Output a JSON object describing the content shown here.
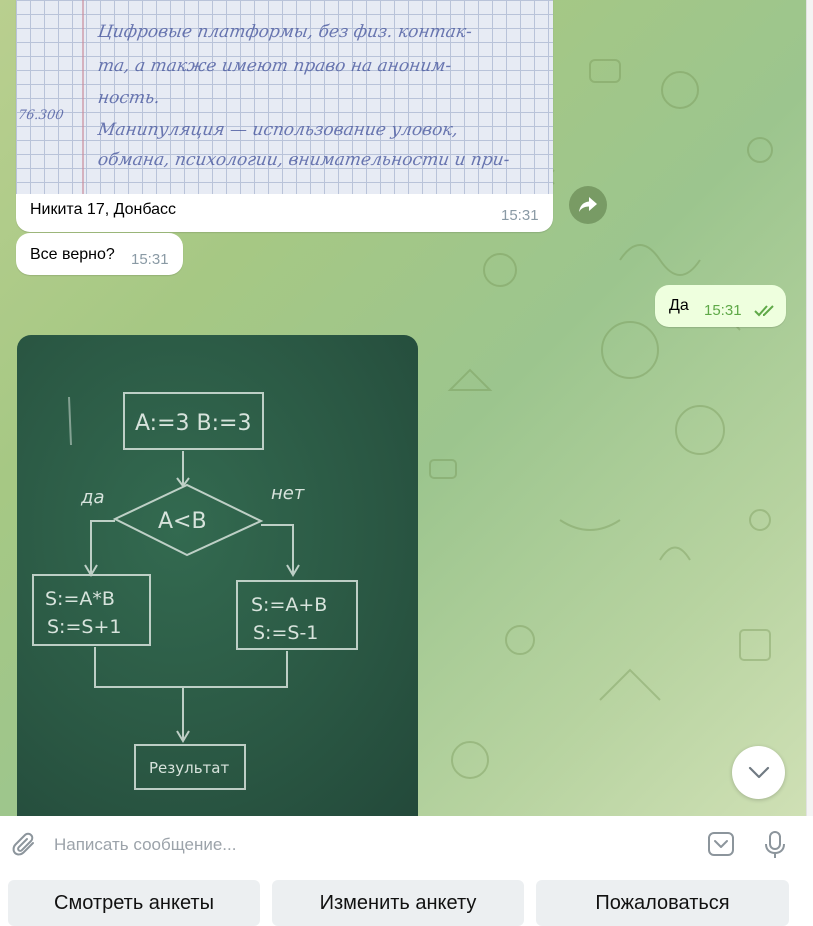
{
  "messages": {
    "photo_caption": "Никита 17, Донбасс",
    "photo_caption_time": "15:31",
    "question_text": "Все верно?",
    "question_time": "15:31",
    "reply_text": "Да",
    "reply_time": "15:31"
  },
  "notebook_photo": {
    "lines": [
      "Цифровые платформы, без физ. контак-",
      "та, а также имеют право на аноним-",
      "ность.",
      "Манипуляция — использование уловок,",
      "обмана, психологии, внимательности и при-"
    ],
    "margin_note": "76.300"
  },
  "board_photo": {
    "init_block": "A:=3  B:=3",
    "condition": "A<B",
    "yes_label": "да",
    "no_label": "нет",
    "yes_block_line1": "S:=A*B",
    "yes_block_line2": "S:=S+1",
    "no_block_line1": "S:=A+B",
    "no_block_line2": "S:=S-1",
    "result_block": "Результат"
  },
  "composer": {
    "placeholder": "Написать сообщение..."
  },
  "keyboard": {
    "view_profiles": "Смотреть анкеты",
    "edit_profile": "Изменить анкету",
    "report": "Пожаловаться"
  },
  "icons": {
    "attach": "paperclip-icon",
    "sticker": "sticker-icon",
    "mic": "microphone-icon",
    "share": "share-icon",
    "scroll": "chevron-down-icon",
    "read_receipt": "double-check-icon"
  },
  "colors": {
    "outgoing_bubble": "#eeffde",
    "read_check": "#5fa948",
    "chat_background": "#a6c884"
  }
}
